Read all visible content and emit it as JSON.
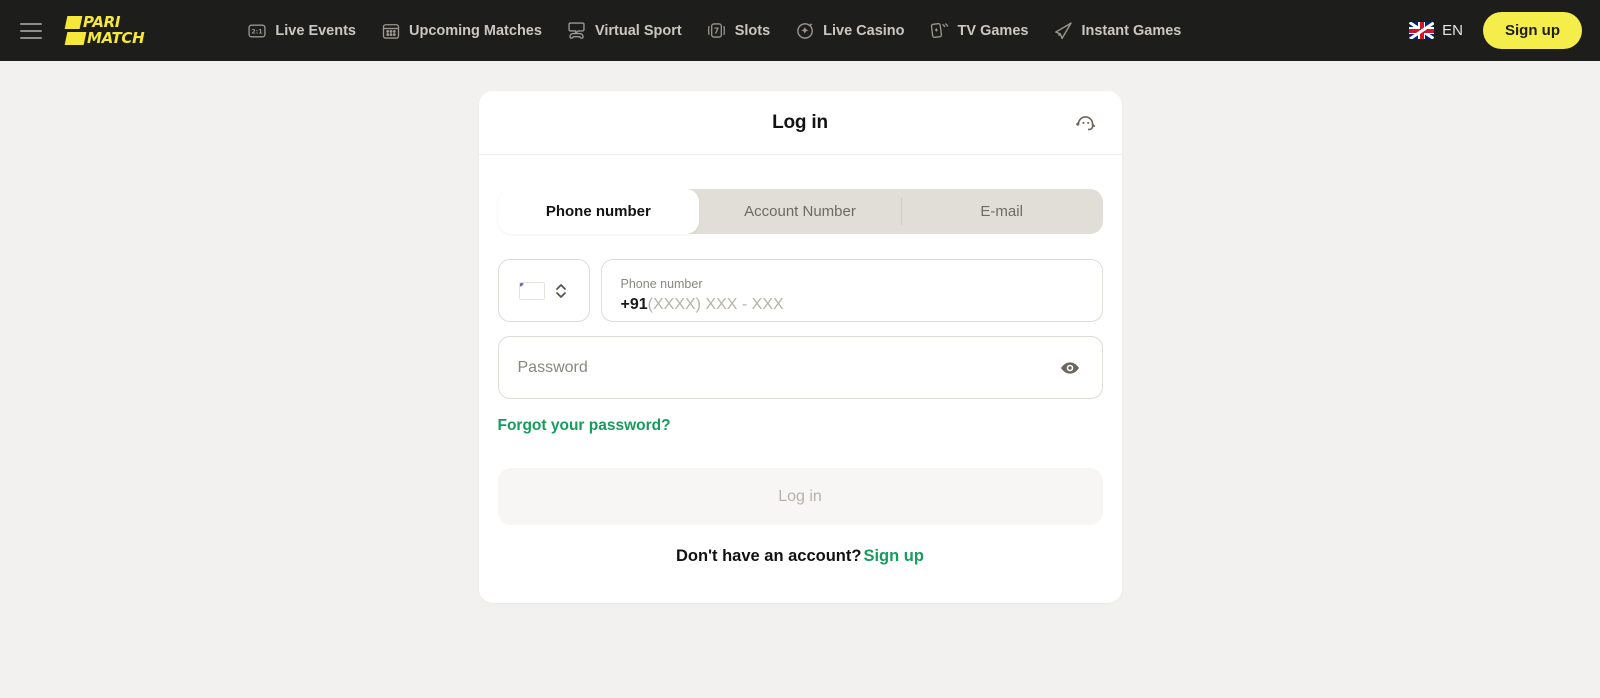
{
  "topnav": {
    "menu_icon": "hamburger-menu-icon",
    "logo": {
      "line1": "PARI",
      "line2": "MATCH"
    },
    "links": [
      {
        "label": "Live Events",
        "icon": "live-score-icon"
      },
      {
        "label": "Upcoming Matches",
        "icon": "calendar-icon"
      },
      {
        "label": "Virtual Sport",
        "icon": "gamepad-screen-icon"
      },
      {
        "label": "Slots",
        "icon": "slot-seven-icon"
      },
      {
        "label": "Live Casino",
        "icon": "sparkle-icon"
      },
      {
        "label": "TV Games",
        "icon": "playing-cards-icon"
      },
      {
        "label": "Instant Games",
        "icon": "rocket-icon"
      }
    ],
    "language": {
      "label": "EN",
      "flag": "uk-flag-icon"
    },
    "signup_button": "Sign up"
  },
  "card": {
    "title": "Log in",
    "support_icon": "headset-support-icon",
    "tabs": [
      {
        "label": "Phone number",
        "active": true
      },
      {
        "label": "Account Number",
        "active": false
      },
      {
        "label": "E-mail",
        "active": false
      }
    ],
    "country": {
      "flag": "india-flag-icon",
      "stepper_icon": "chevron-up-down-icon"
    },
    "phone": {
      "label": "Phone number",
      "prefix": "+91",
      "placeholder": "(XXXX) XXX - XXX"
    },
    "password": {
      "placeholder": "Password",
      "value": "",
      "toggle_icon": "eye-icon"
    },
    "forgot_password": "Forgot your password?",
    "submit_button": "Log in",
    "signup_prompt": "Don't have an account?",
    "signup_link": "Sign up"
  },
  "colors": {
    "nav_bg": "#1d1d1b",
    "brand_yellow": "#f5ee4a",
    "page_bg": "#f2f1ef",
    "card_bg": "#ffffff",
    "accent_green": "#179c5d",
    "tab_track": "#e1ded8"
  }
}
